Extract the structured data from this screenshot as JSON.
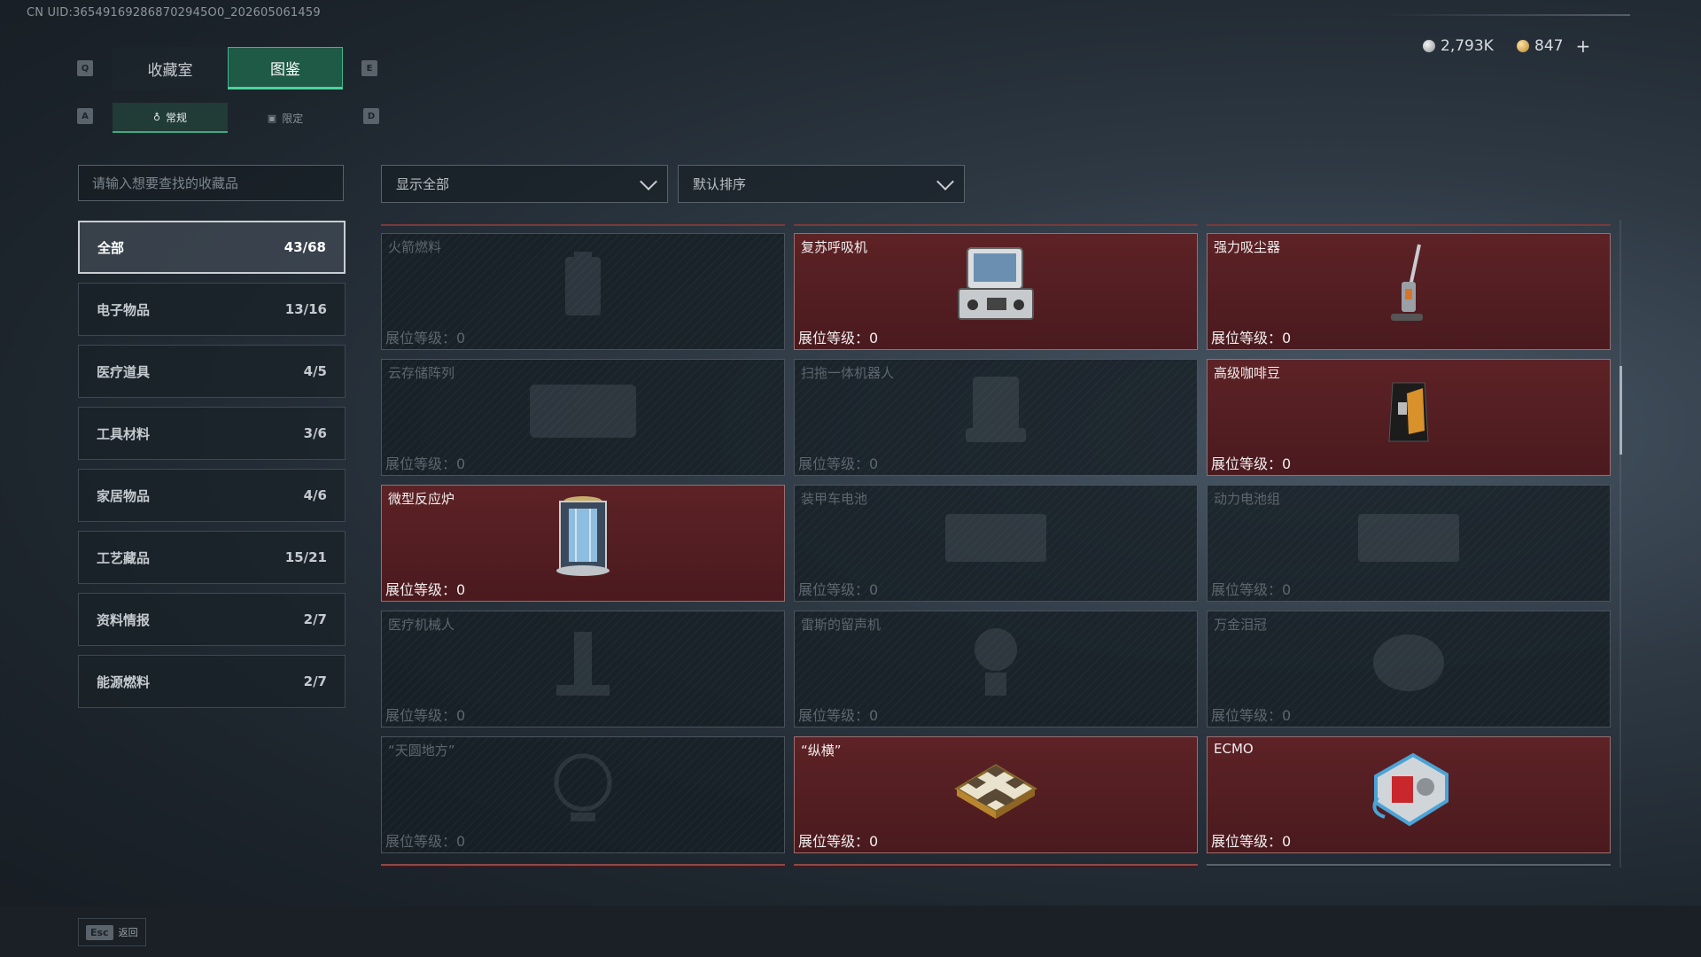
{
  "uid": "CN UID:365491692868702945O0_202605061459",
  "currency": {
    "silver": "2,793K",
    "gold": "847",
    "plus": "+"
  },
  "keys": {
    "prev_tab": "Q",
    "next_tab": "E",
    "prev_sub": "A",
    "next_sub": "D"
  },
  "tabs": [
    "收藏室",
    "图鉴"
  ],
  "subtabs": [
    {
      "label": "常规",
      "icon": "♁"
    },
    {
      "label": "限定",
      "icon": "▣"
    }
  ],
  "search": {
    "placeholder": "请输入想要查找的收藏品"
  },
  "filters": {
    "show": "显示全部",
    "sort": "默认排序"
  },
  "categories": [
    {
      "label": "全部",
      "count": "43/68"
    },
    {
      "label": "电子物品",
      "count": "13/16"
    },
    {
      "label": "医疗道具",
      "count": "4/5"
    },
    {
      "label": "工具材料",
      "count": "3/6"
    },
    {
      "label": "家居物品",
      "count": "4/6"
    },
    {
      "label": "工艺藏品",
      "count": "15/21"
    },
    {
      "label": "资料情报",
      "count": "2/7"
    },
    {
      "label": "能源燃料",
      "count": "2/7"
    }
  ],
  "level_label": "展位等级：0",
  "items": [
    {
      "name": "火箭燃料",
      "owned": false
    },
    {
      "name": "复苏呼吸机",
      "owned": true
    },
    {
      "name": "强力吸尘器",
      "owned": true
    },
    {
      "name": "云存储阵列",
      "owned": false
    },
    {
      "name": "扫拖一体机器人",
      "owned": false
    },
    {
      "name": "高级咖啡豆",
      "owned": true
    },
    {
      "name": "微型反应炉",
      "owned": true
    },
    {
      "name": "装甲车电池",
      "owned": false
    },
    {
      "name": "动力电池组",
      "owned": false
    },
    {
      "name": "医疗机械人",
      "owned": false
    },
    {
      "name": "雷斯的留声机",
      "owned": false
    },
    {
      "name": "万金泪冠",
      "owned": false
    },
    {
      "name": "“天圆地方”",
      "owned": false
    },
    {
      "name": "“纵横”",
      "owned": true
    },
    {
      "name": "ECMO",
      "owned": true
    }
  ],
  "footer": {
    "esc_key": "Esc",
    "esc_label": "返回"
  }
}
